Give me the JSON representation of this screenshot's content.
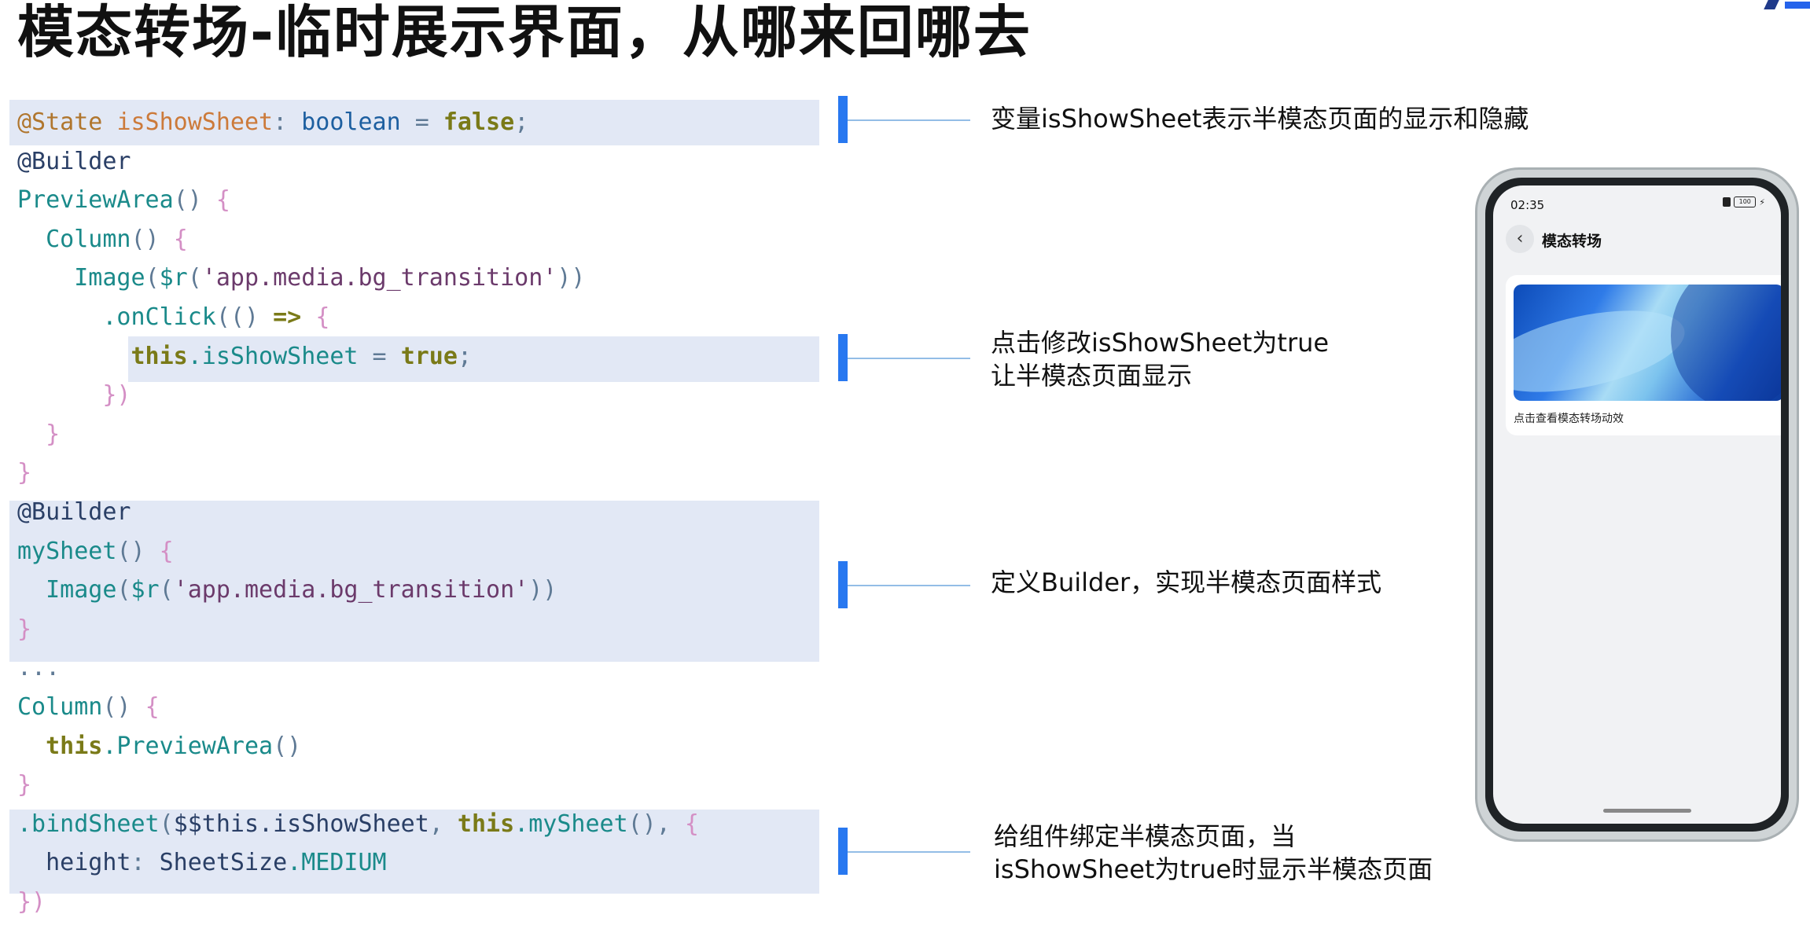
{
  "slide": {
    "title": "模态转场-临时展示界面，从哪来回哪去"
  },
  "code_lines": [
    [
      {
        "t": "@State ",
        "c": "an"
      },
      {
        "t": "isShowSheet",
        "c": "vr"
      },
      {
        "t": ": ",
        "c": "pu"
      },
      {
        "t": "boolean",
        "c": "ty"
      },
      {
        "t": " = ",
        "c": "pu"
      },
      {
        "t": "false",
        "c": "kw"
      },
      {
        "t": ";",
        "c": "pu"
      }
    ],
    [
      {
        "t": "@Builder",
        "c": "dk"
      }
    ],
    [
      {
        "t": "PreviewArea",
        "c": "fn"
      },
      {
        "t": "() ",
        "c": "pu"
      },
      {
        "t": "{",
        "c": "br"
      }
    ],
    [
      {
        "t": "  "
      },
      {
        "t": "Column",
        "c": "fn"
      },
      {
        "t": "() ",
        "c": "pu"
      },
      {
        "t": "{",
        "c": "br"
      }
    ],
    [
      {
        "t": "    "
      },
      {
        "t": "Image",
        "c": "fn"
      },
      {
        "t": "(",
        "c": "pu"
      },
      {
        "t": "$r",
        "c": "fn"
      },
      {
        "t": "(",
        "c": "pu"
      },
      {
        "t": "'app.media.bg_transition'",
        "c": "st"
      },
      {
        "t": "))",
        "c": "pu"
      }
    ],
    [
      {
        "t": "      "
      },
      {
        "t": ".onClick",
        "c": "fn"
      },
      {
        "t": "(() ",
        "c": "pu"
      },
      {
        "t": "=>",
        "c": "kw"
      },
      {
        "t": " "
      },
      {
        "t": "{",
        "c": "br"
      }
    ],
    [
      {
        "t": "        "
      },
      {
        "t": "this",
        "c": "kw"
      },
      {
        "t": ".isShowSheet",
        "c": "fn"
      },
      {
        "t": " = ",
        "c": "pu"
      },
      {
        "t": "true",
        "c": "kw"
      },
      {
        "t": ";",
        "c": "pu"
      }
    ],
    [
      {
        "t": "      "
      },
      {
        "t": "})",
        "c": "br"
      }
    ],
    [
      {
        "t": "  "
      },
      {
        "t": "}",
        "c": "br"
      }
    ],
    [
      {
        "t": "}",
        "c": "br"
      }
    ],
    [
      {
        "t": "@Builder",
        "c": "dk"
      }
    ],
    [
      {
        "t": "mySheet",
        "c": "fn"
      },
      {
        "t": "() ",
        "c": "pu"
      },
      {
        "t": "{",
        "c": "br"
      }
    ],
    [
      {
        "t": "  "
      },
      {
        "t": "Image",
        "c": "fn"
      },
      {
        "t": "(",
        "c": "pu"
      },
      {
        "t": "$r",
        "c": "fn"
      },
      {
        "t": "(",
        "c": "pu"
      },
      {
        "t": "'app.media.bg_transition'",
        "c": "st"
      },
      {
        "t": "))",
        "c": "pu"
      }
    ],
    [
      {
        "t": "}",
        "c": "br"
      }
    ],
    [
      {
        "t": "...",
        "c": "pu"
      }
    ],
    [
      {
        "t": "Column",
        "c": "fn"
      },
      {
        "t": "() ",
        "c": "pu"
      },
      {
        "t": "{",
        "c": "br"
      }
    ],
    [
      {
        "t": "  "
      },
      {
        "t": "this",
        "c": "kw"
      },
      {
        "t": ".PreviewArea",
        "c": "fn"
      },
      {
        "t": "()",
        "c": "pu"
      }
    ],
    [
      {
        "t": "}",
        "c": "br"
      }
    ],
    [
      {
        "t": ".bindSheet",
        "c": "fn"
      },
      {
        "t": "(",
        "c": "pu"
      },
      {
        "t": "$$this.isShowSheet",
        "c": "dk"
      },
      {
        "t": ", ",
        "c": "pu"
      },
      {
        "t": "this",
        "c": "kw"
      },
      {
        "t": ".mySheet",
        "c": "fn"
      },
      {
        "t": "(), ",
        "c": "pu"
      },
      {
        "t": "{",
        "c": "br"
      }
    ],
    [
      {
        "t": "  "
      },
      {
        "t": "height",
        "c": "dk"
      },
      {
        "t": ": ",
        "c": "pu"
      },
      {
        "t": "SheetSize",
        "c": "dk"
      },
      {
        "t": ".MEDIUM",
        "c": "fn"
      }
    ],
    [
      {
        "t": "})",
        "c": "br"
      }
    ]
  ],
  "annotations": [
    {
      "lines": [
        "变量isShowSheet表示半模态页面的显示和隐藏"
      ]
    },
    {
      "lines": [
        "点击修改isShowSheet为true",
        "让半模态页面显示"
      ]
    },
    {
      "lines": [
        "定义Builder，实现半模态页面样式"
      ]
    },
    {
      "lines": [
        "给组件绑定半模态页面，当",
        "isShowSheet为true时显示半模态页面"
      ]
    }
  ],
  "phone": {
    "status_time": "02:35",
    "battery": "100",
    "back_icon": "chevron-left-icon",
    "nav_title": "模态转场",
    "card_caption": "点击查看模态转场动效"
  },
  "colors": {
    "highlight": "#e2e8f5",
    "marker": "#2878f0",
    "connector": "#93bde6"
  }
}
